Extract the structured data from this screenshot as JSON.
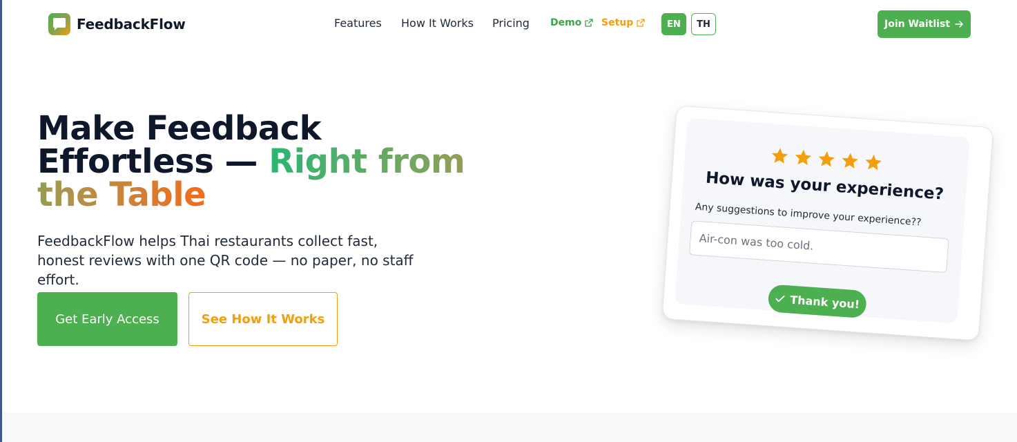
{
  "brand": {
    "name": "FeedbackFlow"
  },
  "nav": {
    "links": [
      {
        "label": "Features"
      },
      {
        "label": "How It Works"
      },
      {
        "label": "Pricing"
      }
    ],
    "demo_label": "Demo",
    "setup_label": "Setup",
    "lang_en": "EN",
    "lang_th": "TH",
    "join_label": "Join Waitlist"
  },
  "hero": {
    "title_part1": "Make Feedback Effortless — ",
    "title_part2": "Right from the Table",
    "subtitle": "FeedbackFlow helps Thai restaurants collect fast, honest reviews with one QR code — no paper, no staff effort.",
    "primary_cta": "Get Early Access",
    "secondary_cta": "See How It Works"
  },
  "card": {
    "rating": 5,
    "question": "How was your experience?",
    "suggestion_label": "Any suggestions to improve your experience??",
    "input_value": "Air-con was too cold.",
    "thanks_label": "Thank you!"
  },
  "colors": {
    "primary": "#4caf50",
    "accent": "#f59e0b",
    "star": "#f59e0b",
    "text_dark": "#0f172a"
  }
}
